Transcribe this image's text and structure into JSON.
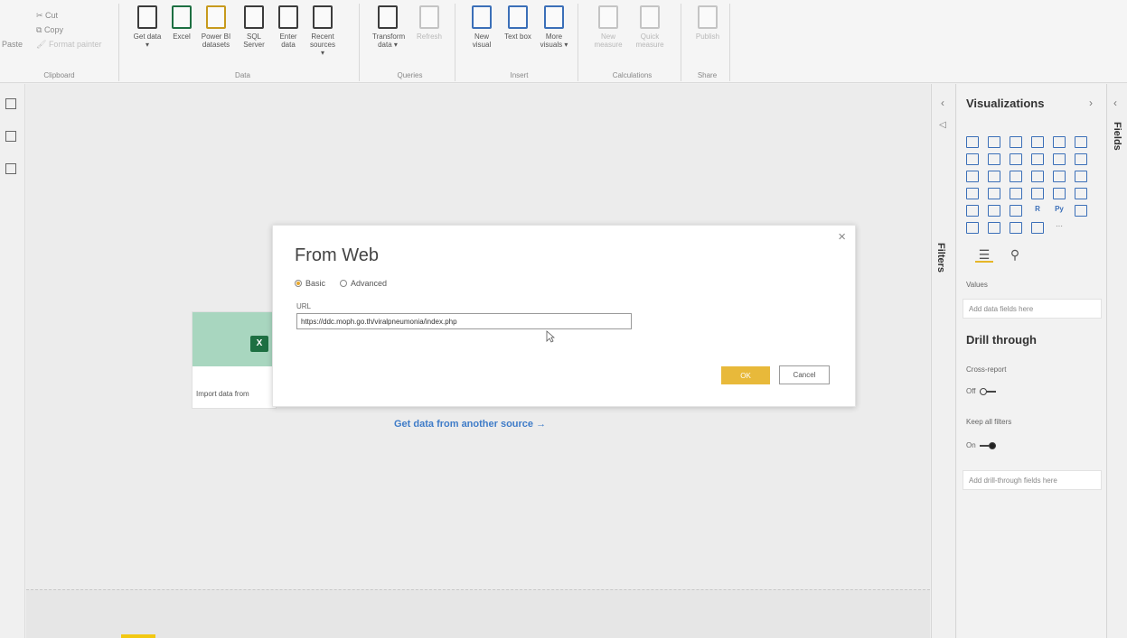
{
  "ribbon": {
    "clipboard": {
      "paste": "Paste",
      "cut": "Cut",
      "copy": "Copy",
      "format_painter": "Format painter",
      "group": "Clipboard"
    },
    "data": {
      "group": "Data",
      "buttons": [
        {
          "label": "Get data",
          "has_menu": true
        },
        {
          "label": "Excel"
        },
        {
          "label": "Power BI datasets"
        },
        {
          "label": "SQL Server"
        },
        {
          "label": "Enter data"
        },
        {
          "label": "Recent sources",
          "has_menu": true
        }
      ]
    },
    "queries": {
      "group": "Queries",
      "buttons": [
        {
          "label": "Transform data",
          "has_menu": true
        },
        {
          "label": "Refresh",
          "disabled": true
        }
      ]
    },
    "insert": {
      "group": "Insert",
      "buttons": [
        {
          "label": "New visual"
        },
        {
          "label": "Text box"
        },
        {
          "label": "More visuals",
          "has_menu": true
        }
      ]
    },
    "calculations": {
      "group": "Calculations",
      "buttons": [
        {
          "label": "New measure",
          "disabled": true
        },
        {
          "label": "Quick measure",
          "disabled": true
        }
      ]
    },
    "share": {
      "group": "Share",
      "buttons": [
        {
          "label": "Publish",
          "disabled": true
        }
      ]
    }
  },
  "canvas": {
    "tile_label": "Import data from",
    "another_source": "Get data from another source →"
  },
  "dialog": {
    "title": "From Web",
    "close": "×",
    "mode_basic": "Basic",
    "mode_advanced": "Advanced",
    "selected_mode": "Basic",
    "url_label": "URL",
    "url_value": "https://ddc.moph.go.th/viralpneumonia/index.php",
    "ok": "OK",
    "cancel": "Cancel"
  },
  "filters_pane": {
    "label": "Filters"
  },
  "viz_pane": {
    "title": "Visualizations",
    "values_label": "Values",
    "add_data_fields": "Add data fields here",
    "drill_through_title": "Drill through",
    "cross_report_label": "Cross-report",
    "cross_report_state": "Off",
    "keep_filters_label": "Keep all filters",
    "keep_filters_state": "On",
    "add_drill_fields": "Add drill-through fields here",
    "r_visual": "R",
    "py_visual": "Py",
    "more": "···"
  },
  "fields_pane": {
    "label": "Fields"
  },
  "colors": {
    "accent_yellow": "#e8b93a",
    "link_blue": "#3f7cc8",
    "excel_green": "#1d6f42"
  }
}
